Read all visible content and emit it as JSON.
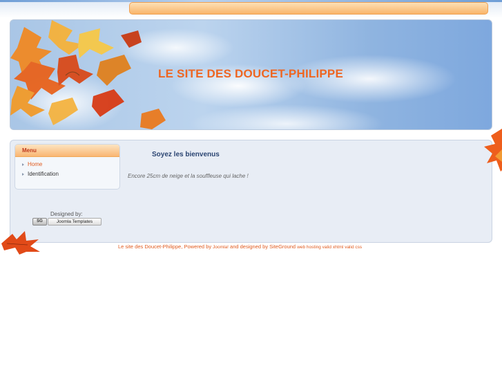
{
  "header": {
    "title": "LE SITE DES DOUCET-PHILIPPE"
  },
  "menu": {
    "title": "Menu",
    "items": [
      {
        "label": "Home",
        "active": true
      },
      {
        "label": "Identification",
        "active": false
      }
    ]
  },
  "credits": {
    "designed_by": "Designed by:",
    "sg_logo": "SG",
    "joomla_templates": "Joomla Templates"
  },
  "content": {
    "heading": "Soyez les bienvenus",
    "text": "Encore 25cm de neige et la souffleuse qui lache !"
  },
  "footer": {
    "site_name": "Le site des Doucet-Philippe",
    "powered_by": ", Powered by ",
    "joomla": "Joomla!",
    "designed_by": " and designed by SiteGround ",
    "links": "web hosting valid xhtml valid css"
  },
  "colors": {
    "accent_orange": "#ee6622",
    "heading_blue": "#2b4572",
    "panel_bg": "#e8edf5"
  }
}
